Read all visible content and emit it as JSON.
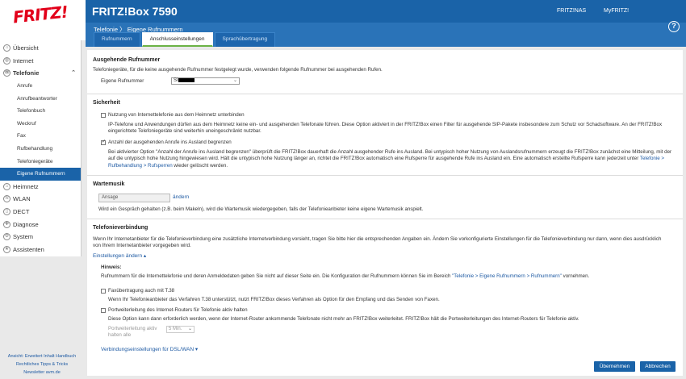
{
  "header": {
    "brand": "FRITZ!",
    "product": "FRITZ!Box 7590",
    "links": [
      "FRITZ!NAS",
      "MyFRITZ!"
    ]
  },
  "breadcrumb": {
    "section": "Telefonie",
    "separator": "〉",
    "page": "Eigene Rufnummern"
  },
  "tabs": [
    {
      "label": "Rufnummern",
      "active": false
    },
    {
      "label": "Anschlusseinstellungen",
      "active": true
    },
    {
      "label": "Sprachübertragung",
      "active": false
    }
  ],
  "sidebar": {
    "items": [
      {
        "label": "Übersicht",
        "icon": "home-icon"
      },
      {
        "label": "Internet",
        "icon": "globe-icon"
      },
      {
        "label": "Telefonie",
        "icon": "phone-icon",
        "expanded": true
      },
      {
        "label": "Heimnetz",
        "icon": "network-icon"
      },
      {
        "label": "WLAN",
        "icon": "wifi-icon"
      },
      {
        "label": "DECT",
        "icon": "dect-icon"
      },
      {
        "label": "Diagnose",
        "icon": "diagnose-icon"
      },
      {
        "label": "System",
        "icon": "gear-icon"
      },
      {
        "label": "Assistenten",
        "icon": "wizard-icon"
      }
    ],
    "sub_items": [
      "Anrufe",
      "Anrufbeantworter",
      "Telefonbuch",
      "Weckruf",
      "Fax",
      "Rufbehandlung",
      "Telefoniegeräte",
      "Eigene Rufnummern"
    ],
    "active_sub": "Eigene Rufnummern",
    "footer": [
      "Ansicht: Erweitert",
      "Inhalt",
      "Handbuch",
      "Rechtliches",
      "Tipps & Tricks",
      "Newsletter",
      "avm.de"
    ]
  },
  "outgoing": {
    "title": "Ausgehende Rufnummer",
    "description": "Telefoniegeräte, für die keine ausgehende Rufnummer festgelegt wurde, verwenden folgende Rufnummer bei ausgehenden Rufen.",
    "field_label": "Eigene Rufnummer",
    "select_value": "SI"
  },
  "security": {
    "title": "Sicherheit",
    "option1_label": "Nutzung von Internettelefonie aus dem Heimnetz unterbinden",
    "option1_checked": false,
    "option1_desc": "IP-Telefone und Anwendungen dürfen aus dem Heimnetz keine ein- und ausgehenden Telefonate führen. Diese Option aktiviert in der FRITZ!Box einen Filter für ausgehende SIP-Pakete insbesondere zum Schutz vor Schadsoftware. An der FRITZ!Box eingerichtete Telefoniegeräte sind weiterhin uneingeschränkt nutzbar.",
    "option2_label": "Anzahl der ausgehenden Anrufe ins Ausland begrenzen",
    "option2_checked": true,
    "option2_desc": "Bei aktivierter Option \"Anzahl der Anrufe ins Ausland begrenzen\" überprüft die FRITZ!Box dauerhaft die Anzahl ausgehender Rufe ins Ausland. Bei untypisch hoher Nutzung von Auslandsrufnummern erzeugt die FRITZ!Box zunächst eine Mitteilung, mit der auf die untypisch hohe Nutzung hingewiesen wird. Hält die untypisch hohe Nutzung länger an, richtet die FRITZ!Box automatisch eine Rufsperre für ausgehende Rufe ins Ausland ein. Eine automatisch erstellte Rufsperre kann jederzeit unter",
    "option2_link": "Telefonie > Rufbehandlung > Rufsperren",
    "option2_tail": " wieder gelöscht werden."
  },
  "music": {
    "title": "Wartemusik",
    "input_value": "Ansage",
    "change_link": "ändern",
    "description": "Wird ein Gespräch gehalten (z.B. beim Makeln), wird die Wartemusik wiedergegeben, falls der Telefonieanbieter keine eigene Wartemusik anspielt."
  },
  "connection": {
    "title": "Telefonieverbindung",
    "description": "Wenn Ihr Internetanbieter für die Telefonieverbindung eine zusätzliche Internetverbindung vorsieht, tragen Sie bitte hier die entsprechenden Angaben ein. Ändern Sie vorkonfigurierte Einstellungen für die Telefonieverbindung nur dann, wenn dies ausdrücklich von Ihrem Internetanbieter vorgegeben wird.",
    "change_link": "Einstellungen ändern ▴",
    "hint_title": "Hinweis:",
    "hint_text": "Rufnummern für die Internettelefonie und deren Anmeldedaten geben Sie nicht auf dieser Seite ein. Die Konfiguration der Rufnummern können Sie im Bereich ",
    "hint_link": "\"Telefonie > Eigene Rufnummern > Rufnummern\"",
    "hint_tail": " vornehmen.",
    "fax_label": "Faxübertragung auch mit T.38",
    "fax_checked": false,
    "fax_desc": "Wenn Ihr Telefonieanbieter das Verfahren T.38 unterstützt, nutzt FRITZ!Box dieses Verfahren als Option für den Empfang und das Senden von Faxen.",
    "forward_label": "Portweiterleitung des Internet-Routers für Telefonie aktiv halten",
    "forward_checked": false,
    "forward_desc": "Diese Option kann dann erforderlich werden, wenn der Internet-Router ankommende Telefonate nicht mehr an FRITZ!Box weiterleitet. FRITZ!Box hält die Portweiterleitungen des Internet-Routers für Telefonie aktiv.",
    "forward_field_label1": "Portweiterleitung aktiv",
    "forward_field_label2": "halten alle",
    "forward_select": "5 Min.",
    "dsl_link": "Verbindungseinstellungen für DSL/WAN ▾"
  },
  "buttons": {
    "apply": "Übernehmen",
    "cancel": "Abbrechen"
  },
  "colors": {
    "header_blue": "#1a63a8",
    "active_tab_underline": "#6bb246",
    "brand_red": "#e2001a"
  }
}
